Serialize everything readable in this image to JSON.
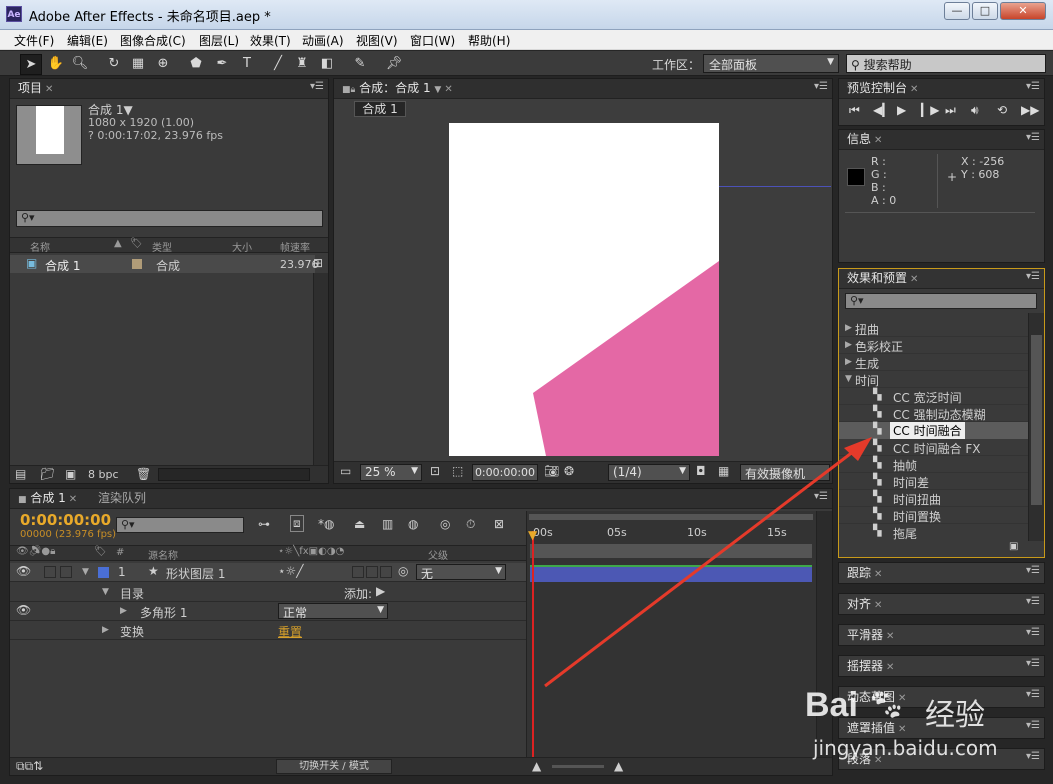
{
  "window": {
    "app_icon": "Ae",
    "title": "Adobe After Effects - 未命名项目.aep *",
    "min": "—",
    "max": "□",
    "close": "✕"
  },
  "menu": [
    "文件(F)",
    "编辑(E)",
    "图像合成(C)",
    "图层(L)",
    "效果(T)",
    "动画(A)",
    "视图(V)",
    "窗口(W)",
    "帮助(H)"
  ],
  "toolbar": {
    "workspace_label": "工作区：",
    "workspace_value": "全部面板",
    "search_help": "搜索帮助"
  },
  "project": {
    "tab": "项目",
    "comp_name": "合成 1▼",
    "comp_size": "1080 x 1920 (1.00)",
    "comp_duration": "? 0:00:17:02, 23.976 fps",
    "columns": [
      "名称",
      "类型",
      "大小",
      "帧速率"
    ],
    "row": {
      "name": "合成 1",
      "type": "合成",
      "fps": "23.976"
    },
    "bpc": "8 bpc"
  },
  "composition": {
    "tab": "合成：合成 1",
    "subtab": "合成 1",
    "zoom": "25 %",
    "timecode": "0:00:00:00",
    "resolution": "(1/4)",
    "camera": "有效摄像机",
    "shape_color": "#e468a5"
  },
  "preview": {
    "tab": "预览控制台"
  },
  "info": {
    "tab": "信息",
    "r": "R :",
    "g": "G :",
    "b": "B :",
    "a": "A : 0",
    "x": "X : -256",
    "y": "Y : 608"
  },
  "effects": {
    "tab": "效果和预置",
    "categories": [
      {
        "label": "扭曲",
        "open": false
      },
      {
        "label": "色彩校正",
        "open": false
      },
      {
        "label": "生成",
        "open": false
      },
      {
        "label": "时间",
        "open": true
      }
    ],
    "items": [
      "CC 宽泛时间",
      "CC 强制动态模糊",
      "CC 时间融合",
      "CC 时间融合 FX",
      "抽帧",
      "时间差",
      "时间扭曲",
      "时间置换",
      "拖尾"
    ],
    "selected": "CC 时间融合"
  },
  "side_panels": [
    "跟踪",
    "对齐",
    "平滑器",
    "摇摆器",
    "动态草图",
    "遮罩插值",
    "段落"
  ],
  "timeline": {
    "tab": "合成 1",
    "render_tab": "渲染队列",
    "timecode": "0:00:00:00",
    "frame_info": "00000 (23.976 fps)",
    "columns": {
      "num": "#",
      "source": "源名称",
      "mode": "父级"
    },
    "layer_num": "1",
    "layer_name": "形状图层 1",
    "parent": "无",
    "contents": "目录",
    "add": "添加:",
    "polygon": "多角形 1",
    "blend": "正常",
    "transform": "变换",
    "reset": "重置",
    "ruler": [
      "00s",
      "05s",
      "10s",
      "15s"
    ],
    "switch_mode": "切换开关 / 模式"
  },
  "watermark": {
    "line1": "Bai",
    "line2": "经验",
    "url": "jingyan.baidu.com"
  },
  "arrow_color": "#e53a2a"
}
